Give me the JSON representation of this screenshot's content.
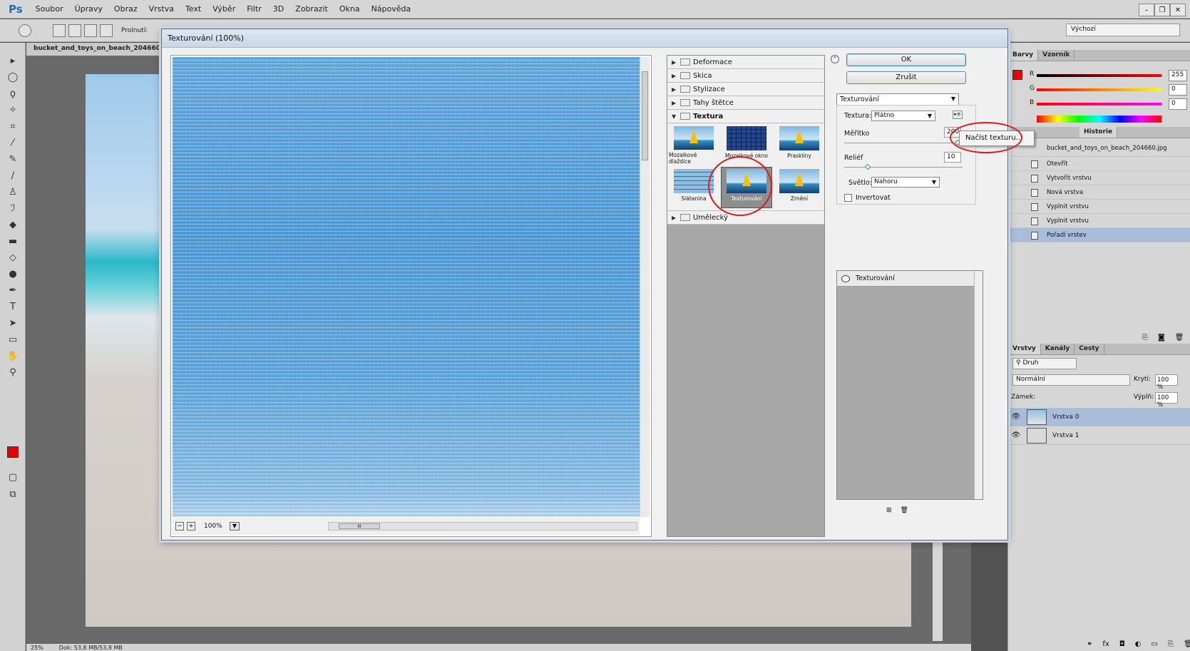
{
  "menubar": {
    "logo": "Ps",
    "items": [
      "Soubor",
      "Úpravy",
      "Obraz",
      "Vrstva",
      "Text",
      "Výběr",
      "Filtr",
      "3D",
      "Zobrazit",
      "Okna",
      "Nápověda"
    ]
  },
  "options_bar": {
    "feather_label": "Prolnutí:",
    "workspace": "Výchozí"
  },
  "document": {
    "tab_title": "bucket_and_toys_on_beach_204660.jpg"
  },
  "status_bar": {
    "zoom": "25%",
    "doc_size": "Dok: 53,8 MB/53,8 MB"
  },
  "dialog": {
    "title": "Texturování (100%)",
    "preview_zoom": "100%",
    "filter_categories": [
      {
        "label": "Deformace",
        "open": false
      },
      {
        "label": "Skica",
        "open": false
      },
      {
        "label": "Stylizace",
        "open": false
      },
      {
        "label": "Tahy štětce",
        "open": false
      },
      {
        "label": "Textura",
        "open": true
      }
    ],
    "after_category": "Umělecký",
    "thumbnails": [
      {
        "label": "Mozaikové dlaždice",
        "style": "sea",
        "selected": false
      },
      {
        "label": "Mozaikové okno",
        "style": "mosaic",
        "selected": false
      },
      {
        "label": "Praskliny",
        "style": "sea",
        "selected": false
      },
      {
        "label": "Slátanina",
        "style": "tiles",
        "selected": false
      },
      {
        "label": "Texturování",
        "style": "sea",
        "selected": true
      },
      {
        "label": "Zrnění",
        "style": "sea",
        "selected": false
      }
    ],
    "ok_label": "OK",
    "cancel_label": "Zrušit",
    "filter_select": "Texturování",
    "texture_label": "Textura:",
    "texture_value": "Plátno",
    "scale_label": "Měřítko",
    "scale_value": "200",
    "relief_label": "Reliéf",
    "relief_value": "10",
    "light_label": "Světlo:",
    "light_value": "Nahoru",
    "invert_label": "Invertovat",
    "popup_item": "Načíst texturu...",
    "effect_layer": "Texturování"
  },
  "color_panel": {
    "tabs": [
      "Barvy",
      "Vzorník"
    ],
    "channels": [
      {
        "name": "R",
        "value": "255"
      },
      {
        "name": "G",
        "value": "0"
      },
      {
        "name": "B",
        "value": "0"
      }
    ]
  },
  "history_panel": {
    "tab": "Historie",
    "snapshot": "bucket_and_toys_on_beach_204660.jpg",
    "items": [
      "Otevřít",
      "Vytvořit vrstvu",
      "Nová vrstva",
      "Vyplnit vrstvu",
      "Vyplnit vrstvu",
      "Pořadí vrstev"
    ],
    "selected_index": 5
  },
  "layers_panel": {
    "tabs": [
      "Vrstvy",
      "Kanály",
      "Cesty"
    ],
    "kind": "Druh",
    "blend_mode": "Normální",
    "opacity_label": "Krytí:",
    "opacity_value": "100 %",
    "lock_label": "Zámek:",
    "fill_label": "Výplň:",
    "fill_value": "100 %",
    "layers": [
      {
        "name": "Vrstva 0",
        "selected": true
      },
      {
        "name": "Vrstva 1",
        "selected": false
      }
    ]
  },
  "colors": {
    "foreground": "#e60000",
    "background": "#ffffff",
    "annotation": "#e01b1b"
  }
}
